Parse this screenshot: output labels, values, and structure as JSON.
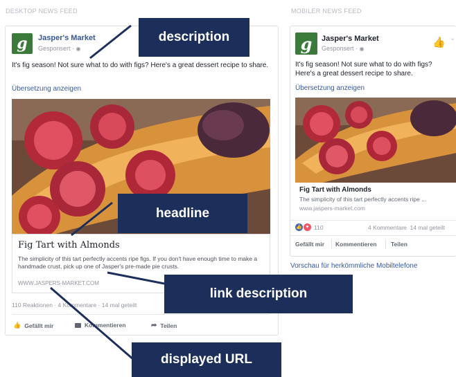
{
  "sections": {
    "desktop_label": "DESKTOP NEWS FEED",
    "mobile_label": "MOBILER NEWS FEED"
  },
  "post": {
    "brand": "Jasper's Market",
    "sponsored": "Gesponsert",
    "text": "It's fig season! Not sure what to do with figs? Here's a great dessert recipe to share.",
    "translate": "Übersetzung anzeigen",
    "headline": "Fig Tart with Almonds",
    "link_description": "The simplicity of this tart perfectly accents ripe figs. If you don't have enough time to make a handmade crust, pick up one of Jasper's pre-made pie crusts.",
    "mobile_link_description": "The simplicity of this tart perfectly accents ripe ...",
    "display_url": "WWW.JASPERS-MARKET.COM",
    "mobile_url": "www.jaspers-market.com"
  },
  "desktop": {
    "reactions": "110 Reaktionen",
    "comments": "4 Kommentare",
    "shares": "14 mal geteilt",
    "like": "Gefällt mir",
    "comment": "Kommentieren",
    "share": "Teilen"
  },
  "mobile": {
    "reaction_count": "110",
    "comments": "4 Kommentare",
    "shares": "14 mal geteilt",
    "like": "Gefällt mir",
    "comment": "Kommentieren",
    "share": "Teilen",
    "preview_link": "Vorschau für herkömmliche Mobiltelefone"
  },
  "callouts": {
    "description": "description",
    "headline": "headline",
    "link_description": "link description",
    "displayed_url": "displayed URL"
  },
  "colors": {
    "callout_bg": "#1c2f5a",
    "link_blue": "#365899",
    "brand_green": "#3b7a3a"
  },
  "icons": {
    "logo": "script-g-logo",
    "globe": "globe-icon",
    "like": "thumbs-up-icon",
    "comment": "comment-icon",
    "share": "share-arrow-icon",
    "like_reaction": "like-reaction-icon",
    "love_reaction": "love-reaction-icon"
  }
}
